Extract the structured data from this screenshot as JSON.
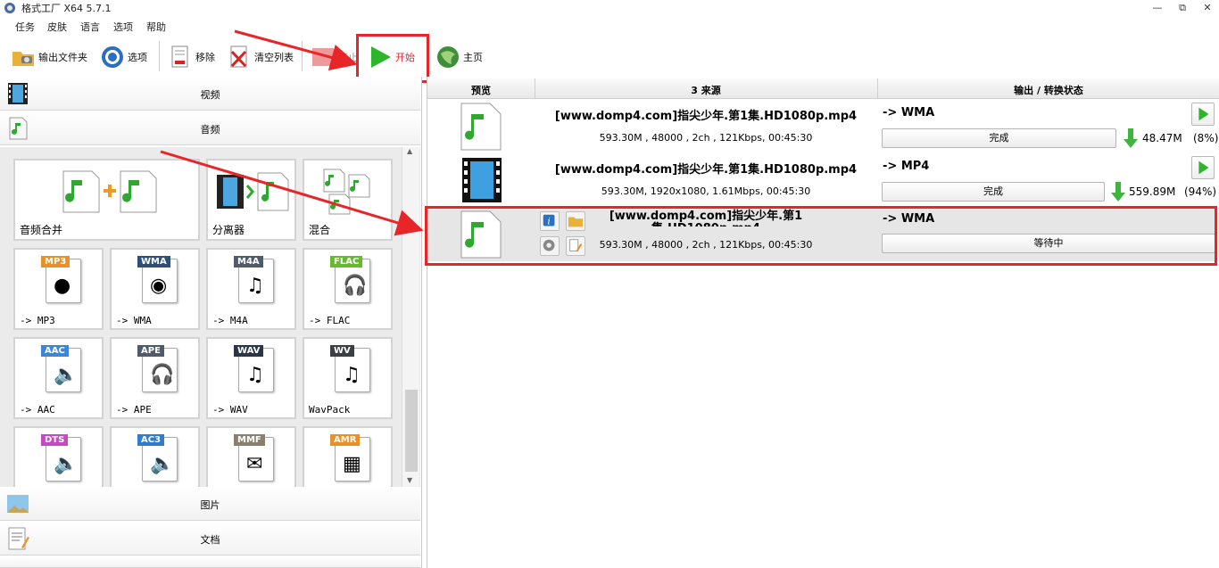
{
  "window": {
    "title": "格式工厂 X64 5.7.1",
    "minimize": "—",
    "restore": "⧉",
    "close": "✕"
  },
  "menu": [
    "任务",
    "皮肤",
    "语言",
    "选项",
    "帮助"
  ],
  "toolbar": {
    "output_folder": "输出文件夹",
    "options": "选项",
    "remove": "移除",
    "clear_list": "清空列表",
    "stop": "停止",
    "start": "开始",
    "home": "主页"
  },
  "categories": {
    "video": "视频",
    "audio": "音频",
    "image": "图片",
    "document": "文档"
  },
  "audio_tiles": [
    {
      "caption": "音频合并"
    },
    {
      "caption": "分离器"
    },
    {
      "caption": "混合"
    }
  ],
  "format_tiles": [
    {
      "tag": "MP3",
      "caption": "-> MP3",
      "color": "#e8912a"
    },
    {
      "tag": "WMA",
      "caption": "-> WMA",
      "color": "#2f4f75"
    },
    {
      "tag": "M4A",
      "caption": "-> M4A",
      "color": "#4f5b68"
    },
    {
      "tag": "FLAC",
      "caption": "-> FLAC",
      "color": "#67b92e"
    },
    {
      "tag": "AAC",
      "caption": "-> AAC",
      "color": "#3c86d8"
    },
    {
      "tag": "APE",
      "caption": "-> APE",
      "color": "#4f5b68"
    },
    {
      "tag": "WAV",
      "caption": "-> WAV",
      "color": "#2a3546"
    },
    {
      "tag": "WV",
      "caption": "WavPack",
      "color": "#3a3f46"
    },
    {
      "tag": "DTS",
      "caption": "",
      "color": "#c548c5"
    },
    {
      "tag": "AC3",
      "caption": "",
      "color": "#2f7cd0"
    },
    {
      "tag": "MMF",
      "caption": "",
      "color": "#8a8070"
    },
    {
      "tag": "AMR",
      "caption": "",
      "color": "#e8912a"
    }
  ],
  "table": {
    "headers": {
      "preview": "预览",
      "source": "3 来源",
      "output": "输出 / 转换状态"
    },
    "rows": [
      {
        "source": "[www.domp4.com]指尖少年.第1集.HD1080p.mp4",
        "meta": "593.30M , 48000 , 2ch , 121Kbps, 00:45:30",
        "format": "-> WMA",
        "status": "完成",
        "size": "48.47M",
        "percent": "(8%)"
      },
      {
        "source": "[www.domp4.com]指尖少年.第1集.HD1080p.mp4",
        "meta": "593.30M, 1920x1080, 1.61Mbps, 00:45:30",
        "format": "-> MP4",
        "status": "完成",
        "size": "559.89M",
        "percent": "(94%)"
      },
      {
        "source_line1": "[www.domp4.com]指尖少年.第1",
        "source_line2": "集.HD1080p.mp4",
        "meta": "593.30M , 48000 , 2ch , 121Kbps, 00:45:30",
        "format": "-> WMA",
        "status": "等待中"
      }
    ]
  },
  "colors": {
    "highlight_red": "#e8262a",
    "play_green": "#2db52d"
  }
}
